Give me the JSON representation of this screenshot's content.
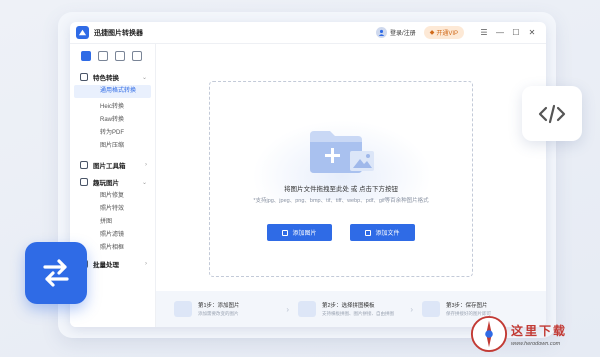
{
  "app": {
    "title": "迅捷图片转换器",
    "login": "登录/注册",
    "vip": "开通VIP",
    "window_controls": [
      "☰",
      "—",
      "☐",
      "✕"
    ]
  },
  "sidebar": {
    "icon_tabs": [
      "convert-tab-icon",
      "edit-tab-icon",
      "image-tab-icon",
      "check-tab-icon"
    ],
    "sections": [
      {
        "label": "特色转换",
        "icon": "convert-icon",
        "items": [
          "通用格式转换",
          "Heic转换",
          "Raw转换",
          "转为PDF",
          "图片压缩"
        ]
      },
      {
        "label": "图片工具箱",
        "icon": "toolbox-icon",
        "items": []
      },
      {
        "label": "趣玩图片",
        "icon": "fun-image-icon",
        "items": [
          "图片修复",
          "照片特效",
          "拼图",
          "照片滤镜",
          "照片相框"
        ]
      },
      {
        "label": "批量处理",
        "icon": "batch-icon",
        "items": []
      }
    ],
    "active_item": "通用格式转换"
  },
  "dropzone": {
    "text": "将图片文件拖拽至此处 或 点击下方按钮",
    "formats": "*支持jpg、jpeg、png、bmp、tif、tiff、webp、pdf、gif等百余种图片格式",
    "add_image": "添加图片",
    "add_file": "添加文件"
  },
  "steps": [
    {
      "title": "第1步：添加图片",
      "desc": "添加需要改变的图片"
    },
    {
      "title": "第2步：选择拼图模板",
      "desc": "支持横板拼图、图片拼接、自由拼图"
    },
    {
      "title": "第3步：保存图片",
      "desc": "保存拼接好的图片即可"
    }
  ],
  "watermark": {
    "cn": "这里下载",
    "url": "www.herodown.com"
  },
  "colors": {
    "accent": "#2f6be6",
    "vip": "#d06a1a"
  }
}
